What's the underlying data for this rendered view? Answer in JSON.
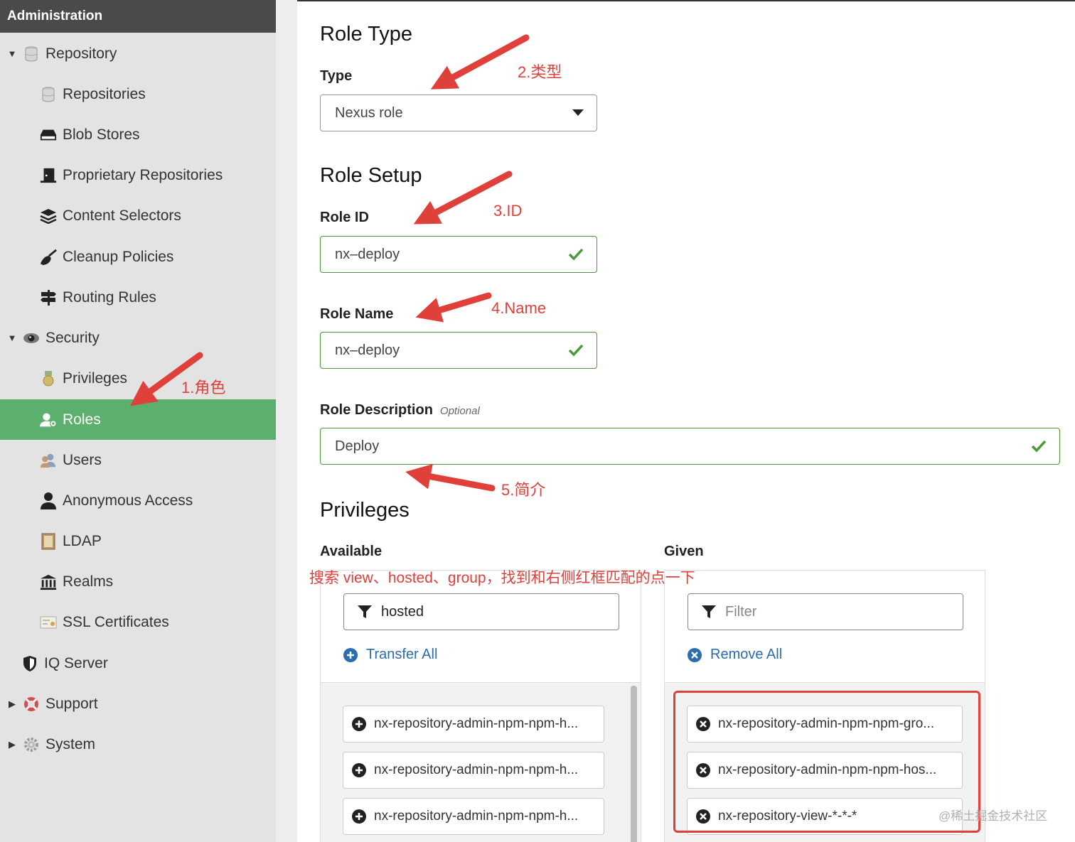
{
  "sidebar": {
    "header": "Administration",
    "items": [
      {
        "label": "Repository",
        "icon": "database-icon"
      },
      {
        "label": "Repositories",
        "icon": "database-icon"
      },
      {
        "label": "Blob Stores",
        "icon": "hard-drive-icon"
      },
      {
        "label": "Proprietary Repositories",
        "icon": "door-icon"
      },
      {
        "label": "Content Selectors",
        "icon": "layers-icon"
      },
      {
        "label": "Cleanup Policies",
        "icon": "broom-icon"
      },
      {
        "label": "Routing Rules",
        "icon": "signpost-icon"
      },
      {
        "label": "Security",
        "icon": "eye-icon"
      },
      {
        "label": "Privileges",
        "icon": "medal-icon"
      },
      {
        "label": "Roles",
        "icon": "user-role-icon"
      },
      {
        "label": "Users",
        "icon": "users-icon"
      },
      {
        "label": "Anonymous Access",
        "icon": "user-icon"
      },
      {
        "label": "LDAP",
        "icon": "book-icon"
      },
      {
        "label": "Realms",
        "icon": "building-icon"
      },
      {
        "label": "SSL Certificates",
        "icon": "certificate-icon"
      },
      {
        "label": "IQ Server",
        "icon": "shield-icon"
      },
      {
        "label": "Support",
        "icon": "lifebuoy-icon"
      },
      {
        "label": "System",
        "icon": "gear-icon"
      }
    ]
  },
  "form": {
    "role_type_title": "Role Type",
    "type_label": "Type",
    "type_value": "Nexus role",
    "role_setup_title": "Role Setup",
    "role_id_label": "Role ID",
    "role_id_value": "nx–deploy",
    "role_name_label": "Role Name",
    "role_name_value": "nx–deploy",
    "role_desc_label": "Role Description",
    "optional": "Optional",
    "role_desc_value": "Deploy",
    "privileges_title": "Privileges"
  },
  "available": {
    "label": "Available",
    "filter_value": "hosted",
    "transfer_all": "Transfer All",
    "items": [
      "nx-repository-admin-npm-npm-h...",
      "nx-repository-admin-npm-npm-h...",
      "nx-repository-admin-npm-npm-h..."
    ]
  },
  "given": {
    "label": "Given",
    "filter_placeholder": "Filter",
    "remove_all": "Remove All",
    "items": [
      "nx-repository-admin-npm-npm-gro...",
      "nx-repository-admin-npm-npm-hos...",
      "nx-repository-view-*-*-*"
    ]
  },
  "annotations": {
    "a1": "1.角色",
    "a2": "2.类型",
    "a3": "3.ID",
    "a4": "4.Name",
    "a5": "5.简介",
    "search_hint": "搜索 view、hosted、group，找到和右侧红框匹配的点一下",
    "color": "#e0403a"
  },
  "watermark": "@稀土掘金技术社区",
  "colors": {
    "active_nav": "#5daf6e",
    "valid_green": "#4a9a3a",
    "link_blue": "#2a6db0"
  }
}
